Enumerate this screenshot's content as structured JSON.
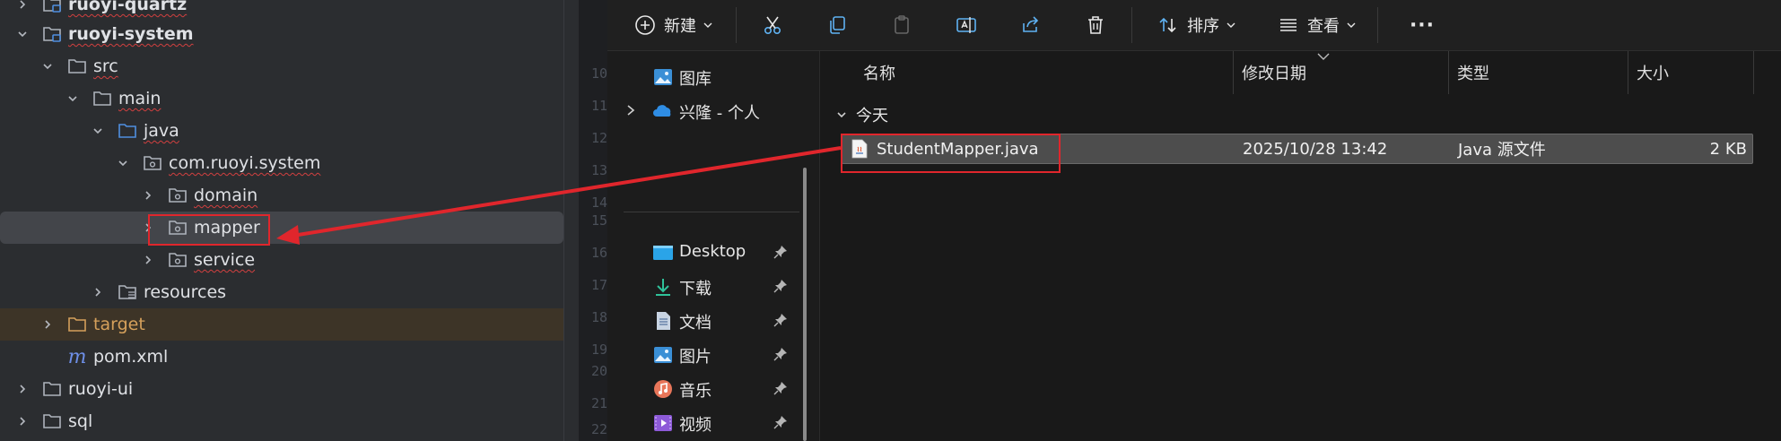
{
  "ide": {
    "tree": [
      {
        "label": "ruoyi-quartz",
        "bold": true
      },
      {
        "label": "ruoyi-system",
        "bold": true
      },
      {
        "label": "src"
      },
      {
        "label": "main"
      },
      {
        "label": "java"
      },
      {
        "label": "com.ruoyi.system"
      },
      {
        "label": "domain"
      },
      {
        "label": "mapper"
      },
      {
        "label": "service"
      },
      {
        "label": "resources"
      },
      {
        "label": "target"
      },
      {
        "label": "pom.xml"
      },
      {
        "label": "ruoyi-ui"
      },
      {
        "label": "sql"
      }
    ],
    "line_numbers": [
      "10",
      "11",
      "12",
      "13",
      "14",
      "15",
      "16",
      "17",
      "18",
      "19",
      "20",
      "21",
      "22"
    ]
  },
  "explorer": {
    "toolbar": {
      "new_label": "新建",
      "sort_label": "排序",
      "view_label": "查看",
      "more_label": "···"
    },
    "nav": {
      "items": [
        {
          "label": "图库",
          "icon": "gallery-icon"
        },
        {
          "label": "兴隆 - 个人",
          "icon": "onedrive-cloud-icon"
        },
        {
          "label": "Desktop",
          "icon": "desktop-icon"
        },
        {
          "label": "下载",
          "icon": "download-icon"
        },
        {
          "label": "文档",
          "icon": "documents-icon"
        },
        {
          "label": "图片",
          "icon": "pictures-icon"
        },
        {
          "label": "音乐",
          "icon": "music-icon"
        },
        {
          "label": "视频",
          "icon": "videos-icon"
        }
      ]
    },
    "columns": {
      "name": "名称",
      "modified": "修改日期",
      "type": "类型",
      "size": "大小"
    },
    "group_label": "今天",
    "file": {
      "name": "StudentMapper.java",
      "modified": "2025/10/28 13:42",
      "type": "Java 源文件",
      "size": "2 KB"
    }
  },
  "colors": {
    "annotation": "#e0262c",
    "folder_stroke": "#aeb3bc",
    "excluded_folder": "#d5a05b",
    "java_folder": "#4f8fe0"
  }
}
